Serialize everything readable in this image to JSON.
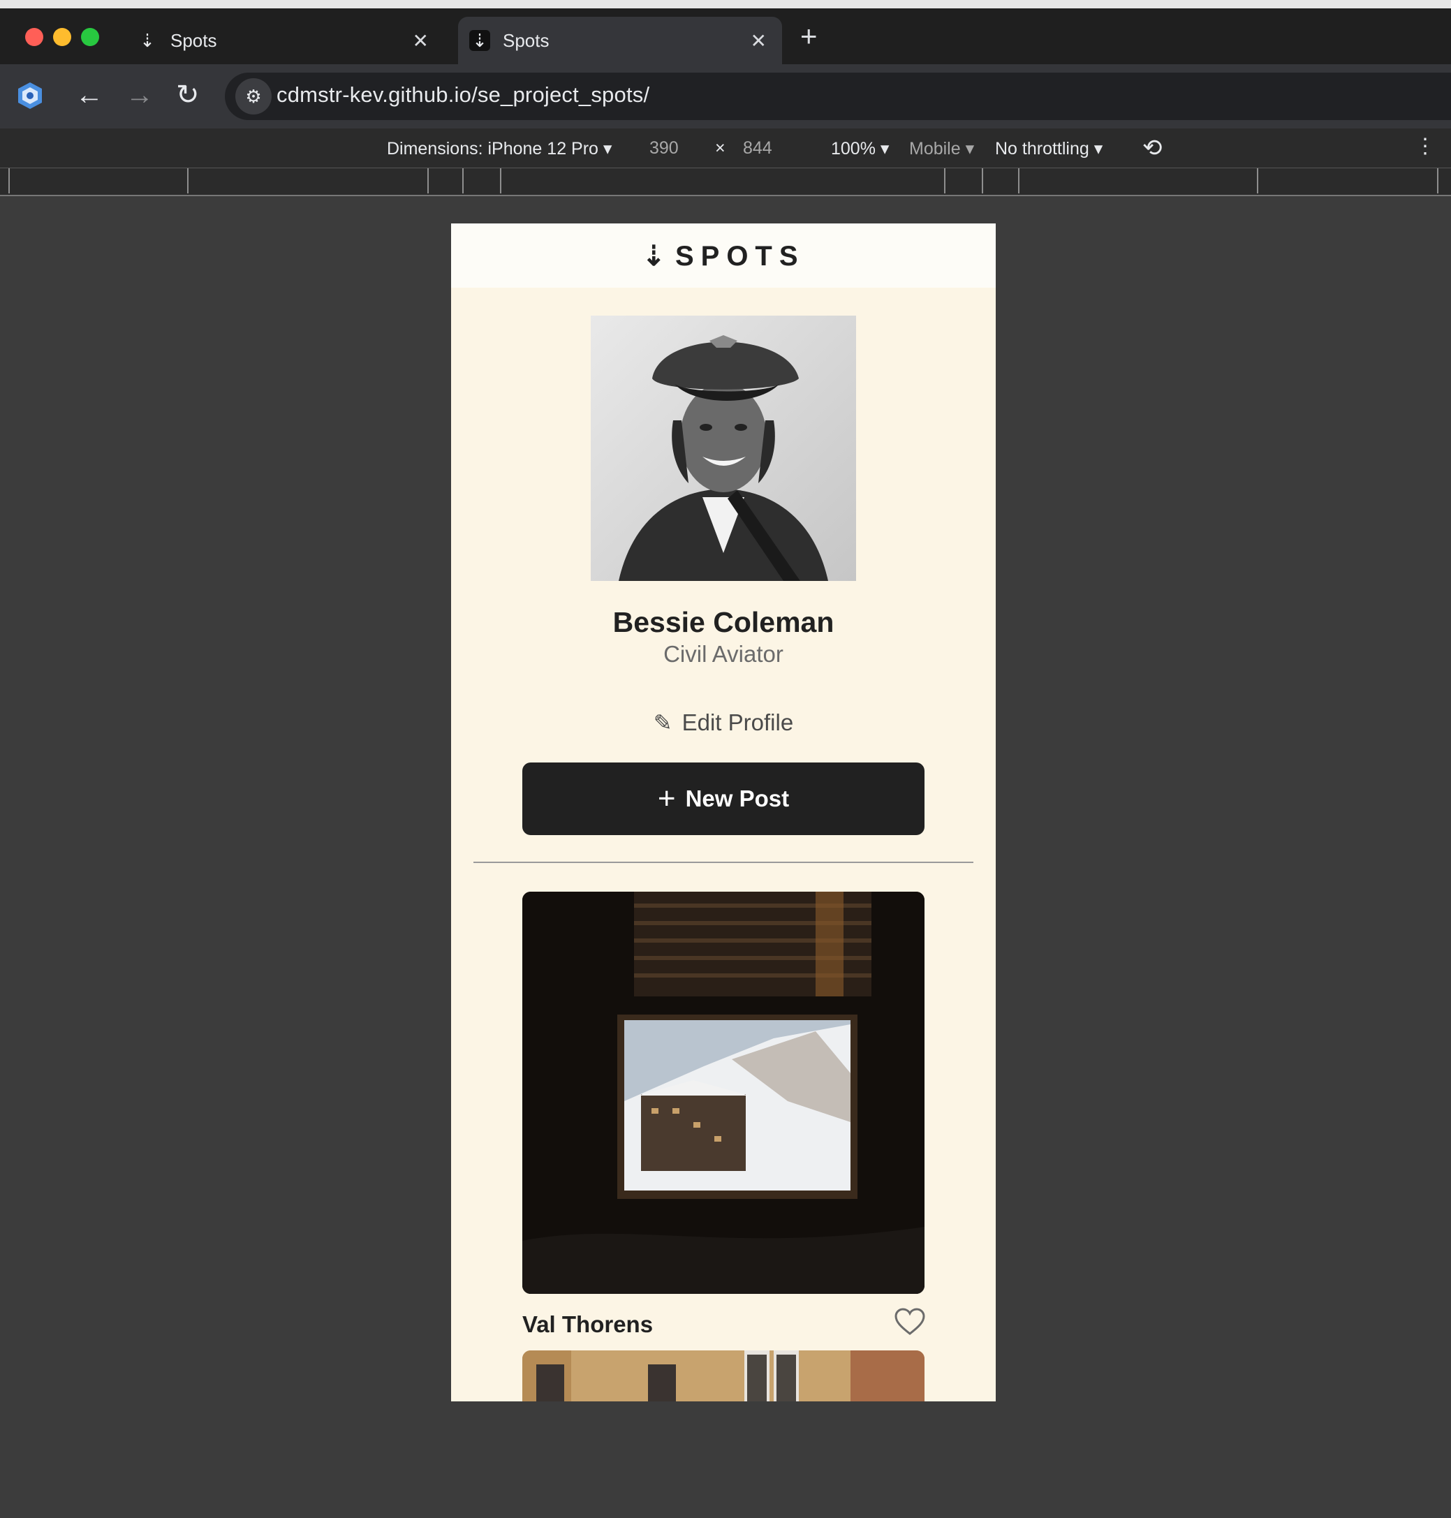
{
  "browser": {
    "tabs": [
      {
        "title": "Spots",
        "active": false
      },
      {
        "title": "Spots",
        "active": true
      }
    ],
    "new_tab_label": "+",
    "url": "cdmstr-kev.github.io/se_project_spots/"
  },
  "devtools": {
    "dimensions_label": "Dimensions: iPhone 12 Pro",
    "width": "390",
    "times": "×",
    "height": "844",
    "zoom": "100%",
    "mode": "Mobile",
    "throttling": "No throttling"
  },
  "page": {
    "logo": "SPOTS",
    "profile": {
      "name": "Bessie Coleman",
      "description": "Civil Aviator",
      "edit_label": "Edit Profile"
    },
    "new_post_label": "New Post",
    "cards": [
      {
        "title": "Val Thorens",
        "liked": false
      }
    ]
  },
  "colors": {
    "page_bg": "#fcf5e5",
    "header_bg": "#fdfcf7",
    "button_bg": "#212121",
    "text_dark": "#212121",
    "text_muted": "#6b6b6b",
    "browser_bg": "#202124"
  }
}
